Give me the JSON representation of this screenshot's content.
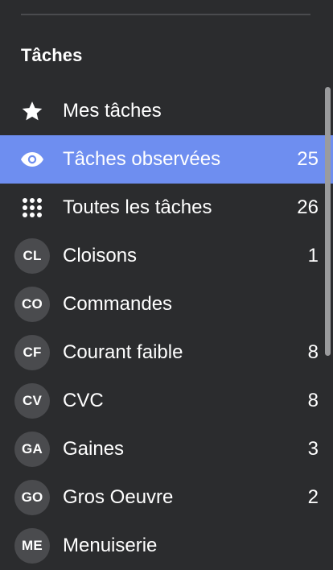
{
  "section": {
    "title": "Tâches"
  },
  "items": [
    {
      "label": "Mes tâches",
      "count": "",
      "icon": "star-icon"
    },
    {
      "label": "Tâches observées",
      "count": "25",
      "icon": "eye-icon",
      "active": true
    },
    {
      "label": "Toutes les tâches",
      "count": "26",
      "icon": "grid-icon"
    },
    {
      "label": "Cloisons",
      "count": "1",
      "avatar": "CL"
    },
    {
      "label": "Commandes",
      "count": "",
      "avatar": "CO"
    },
    {
      "label": "Courant faible",
      "count": "8",
      "avatar": "CF"
    },
    {
      "label": "CVC",
      "count": "8",
      "avatar": "CV"
    },
    {
      "label": "Gaines",
      "count": "3",
      "avatar": "GA"
    },
    {
      "label": "Gros Oeuvre",
      "count": "2",
      "avatar": "GO"
    },
    {
      "label": "Menuiserie",
      "count": "",
      "avatar": "ME"
    }
  ],
  "colors": {
    "background": "#2b2c2e",
    "active_row": "#6e8ef0",
    "avatar": "#4a4b4e",
    "text": "#ffffff",
    "scrollbar": "#9a9b9d"
  }
}
